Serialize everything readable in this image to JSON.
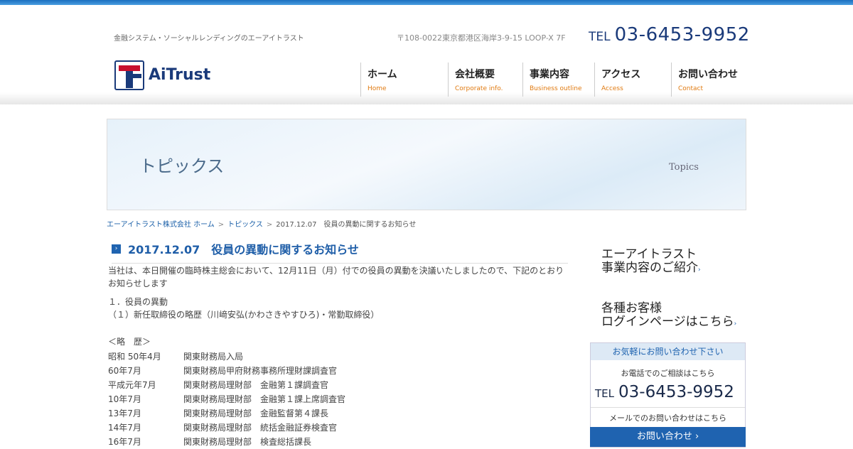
{
  "header": {
    "tagline": "金融システム・ソーシャルレンディングのエーアイトラスト",
    "address": "〒108-0022東京都港区海岸3-9-15 LOOP-X 7F",
    "tel_label": "TEL",
    "tel_number": "03-6453-9952",
    "logo_text": "AiTrust"
  },
  "nav": [
    {
      "jp": "ホーム",
      "en": "Home"
    },
    {
      "jp": "会社概要",
      "en": "Corporate info."
    },
    {
      "jp": "事業内容",
      "en": "Business outline"
    },
    {
      "jp": "アクセス",
      "en": "Access"
    },
    {
      "jp": "お問い合わせ",
      "en": "Contact"
    }
  ],
  "hero": {
    "jp": "トピックス",
    "en": "Topics"
  },
  "breadcrumb": {
    "home": "エーアイトラスト株式会社 ホーム",
    "sep": ">",
    "topics": "トピックス",
    "current": "2017.12.07　役員の異動に関するお知らせ"
  },
  "post": {
    "title": "2017.12.07　役員の異動に関するお知らせ",
    "intro": "当社は、本日開催の臨時株主総会において、12月11日（月）付での役員の異動を決議いたしましたので、下記のとおりお知らせします",
    "item1": "１．役員の異動",
    "item2": "（１）新任取締役の略歴（川﨑安弘(かわさきやすひろ)・常勤取締役）",
    "history_heading": "＜略　歴＞",
    "history": [
      {
        "date": "昭和 50年4月",
        "desc": "関東財務局入局"
      },
      {
        "date": "60年7月",
        "desc": "関東財務局甲府財務事務所理財課調査官"
      },
      {
        "date": "平成元年7月",
        "desc": "関東財務局理財部　金融第１課調査官"
      },
      {
        "date": "10年7月",
        "desc": "関東財務局理財部　金融第１課上席調査官"
      },
      {
        "date": "13年7月",
        "desc": "関東財務局理財部　金融監督第４課長"
      },
      {
        "date": "14年7月",
        "desc": "関東財務局理財部　統括金融証券検査官"
      },
      {
        "date": "16年7月",
        "desc": "関東財務局理財部　検査総括課長"
      }
    ]
  },
  "sidebar": {
    "business_line1": "エーアイトラスト",
    "business_line2": "事業内容のご紹介",
    "login_line1": "各種お客様",
    "login_line2": "ログインページはこちら",
    "arrow": "›",
    "contact_header": "お気軽にお問い合わせ下さい",
    "phone_label": "お電話でのご相談はこちら",
    "tel_label": "TEL",
    "tel_number": "03-6453-9952",
    "mail_label": "メールでのお問い合わせはこちら",
    "button": "お問い合わせ ›"
  }
}
